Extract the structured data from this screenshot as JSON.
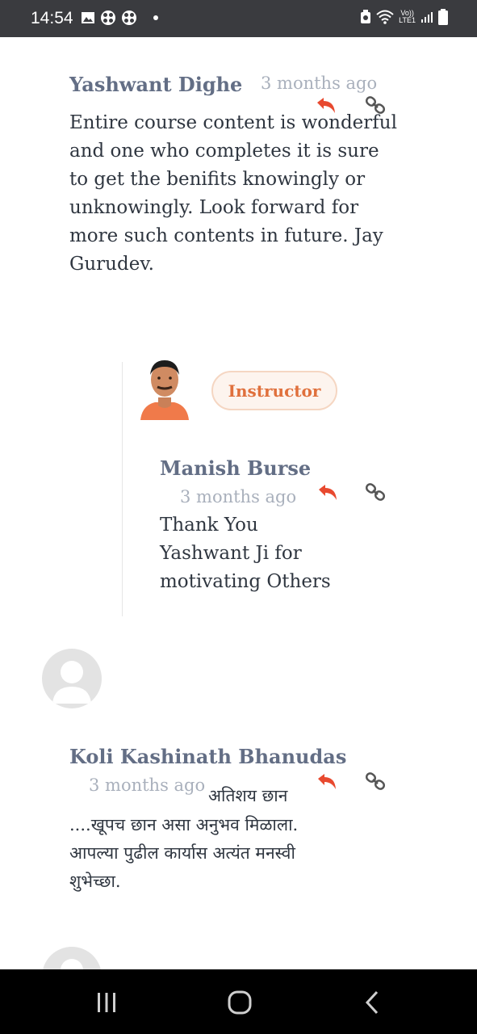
{
  "status_bar": {
    "time": "14:54",
    "left_icons": [
      "gallery-icon",
      "app-icon",
      "app-icon"
    ],
    "right_icons": [
      "battery-saver-icon",
      "wifi-icon",
      "volte-icon",
      "signal-icon",
      "battery-icon"
    ],
    "volte_label": "Vo))",
    "lte_label": "LTE1"
  },
  "comments": [
    {
      "author": "Yashwant Dighe",
      "time": "3 months ago",
      "text": "Entire course content is wonderful and one who completes it is sure to get the benifits knowingly or unknowingly. Look forward for more such contents in future.  Jay Gurudev."
    },
    {
      "badge": "Instructor",
      "author": "Manish Burse",
      "time": "3 months ago",
      "text": "Thank You Yashwant Ji for motivating Others"
    },
    {
      "author": "Koli Kashinath Bhanudas",
      "time": "3 months ago",
      "text_inline": "अतिशय छान",
      "text": "....खूपच छान असा अनुभव मिळाला. आपल्या पुढील कार्यास अत्यंत मनस्वी शुभेच्छा."
    }
  ],
  "colors": {
    "author": "#636e85",
    "time": "#a9b0bc",
    "reply_icon": "#e8492f",
    "badge_text": "#e0703c"
  },
  "nav_bar": {
    "buttons": [
      "recent-apps-icon",
      "home-icon",
      "back-icon"
    ]
  }
}
